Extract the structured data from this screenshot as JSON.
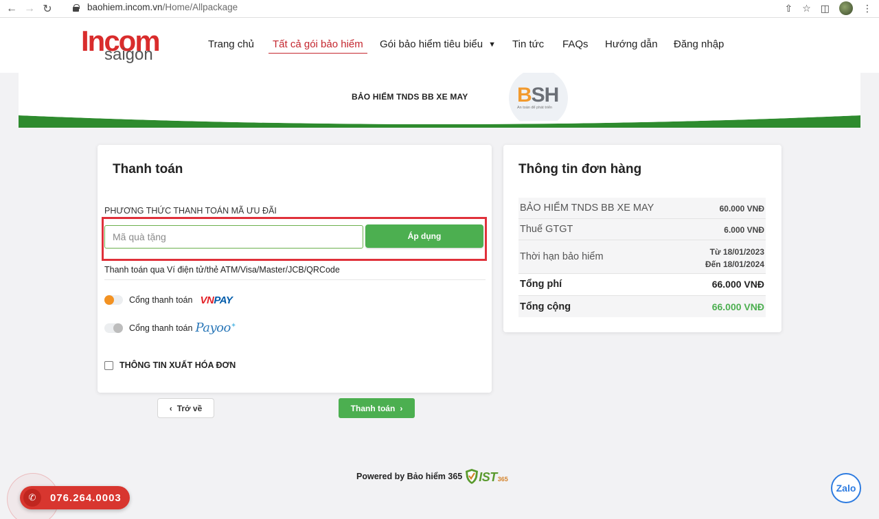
{
  "browser": {
    "url_domain": "baohiem.incom.vn",
    "url_path": "/Home/Allpackage"
  },
  "site": {
    "logo_main": "Incom",
    "logo_sub": "saigon",
    "nav": [
      {
        "label": "Trang chủ"
      },
      {
        "label": "Tất cả gói bảo hiểm"
      },
      {
        "label": "Gói bảo hiểm tiêu biểu"
      },
      {
        "label": "Tin tức"
      },
      {
        "label": "FAQs"
      },
      {
        "label": "Hướng dẫn"
      },
      {
        "label": "Đăng nhập"
      }
    ]
  },
  "banner": {
    "title": "BẢO HIỂM TNDS BB XE MAY",
    "partner_logo_b": "B",
    "partner_logo_sh": "SH",
    "partner_tagline": "An toàn để phát triển",
    "accent_color": "#2e8b2e"
  },
  "payment": {
    "title": "Thanh toán",
    "promo_section_label": "PHƯƠNG THỨC THANH TOÁN MÃ ƯU ĐÃI",
    "promo_placeholder": "Mã quà tặng",
    "promo_value": "",
    "apply_label": "Áp dụng",
    "method_description": "Thanh toán qua Ví điện tử/thẻ ATM/Visa/Master/JCB/QRCode",
    "gateways": [
      {
        "label": "Cổng thanh toán",
        "brand_a": "VN",
        "brand_b": "PAY",
        "selected": true
      },
      {
        "label": "Cổng thanh toán",
        "brand": "Payoo",
        "selected": false
      }
    ],
    "invoice_label": "THÔNG TIN XUẤT HÓA ĐƠN",
    "invoice_checked": false
  },
  "order": {
    "title": "Thông tin đơn hàng",
    "rows": [
      {
        "label": "BẢO HIỂM TNDS BB XE MAY",
        "value": "60.000 VNĐ"
      },
      {
        "label": "Thuế GTGT",
        "value": "6.000 VNĐ"
      },
      {
        "label": "Thời hạn bảo hiểm",
        "value_from": "Từ 18/01/2023",
        "value_to": "Đến 18/01/2024"
      },
      {
        "label": "Tổng phí",
        "value": "66.000 VNĐ"
      },
      {
        "label": "Tổng cộng",
        "value": "66.000 VNĐ"
      }
    ]
  },
  "actions": {
    "back_label": "Trở về",
    "pay_label": "Thanh toán"
  },
  "footer": {
    "powered_by": "Powered by Bảo hiểm 365",
    "ist_text": "IST",
    "ist_num": "365"
  },
  "widgets": {
    "phone_number": "076.264.0003",
    "zalo_label": "Zalo"
  },
  "colors": {
    "brand_red": "#d92c2c",
    "accent_green": "#4caf50",
    "highlight_red": "#e0303a",
    "vnpay_orange": "#f39222"
  }
}
